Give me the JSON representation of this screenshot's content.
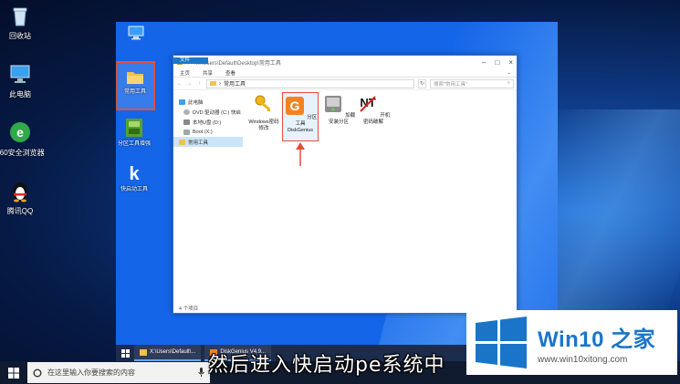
{
  "host_desktop": {
    "icons": [
      {
        "label": "回收站",
        "icon": "recycle-bin-icon"
      },
      {
        "label": "此电脑",
        "icon": "computer-icon"
      },
      {
        "label": "360安全浏览器",
        "icon": "browser-360-icon"
      },
      {
        "label": "腾讯QQ",
        "icon": "qq-penguin-icon"
      }
    ]
  },
  "vm_desktop": {
    "icons": [
      {
        "label": "",
        "icon": "computer-icon"
      },
      {
        "label": "常用工具",
        "icon": "folder-icon"
      },
      {
        "label": "分区工具增强",
        "icon": "partition-tool-icon"
      },
      {
        "label": "快启动工具",
        "icon": "k-tool-icon"
      }
    ]
  },
  "explorer": {
    "title_path": "X:\\Users\\Default\\Desktop\\常用工具",
    "ribbon_tabs": [
      "文件",
      "主页",
      "共享",
      "查看"
    ],
    "address": "常用工具",
    "search_placeholder": "搜索\"常用工具\"",
    "nav_items": [
      {
        "label": "此电脑",
        "icon": "computer-icon"
      },
      {
        "label": "DVD 驱动器 (C:) 快启",
        "icon": "dvd-drive-icon"
      },
      {
        "label": "本地U盘 (D:)",
        "icon": "usb-drive-icon"
      },
      {
        "label": "Boot (X:)",
        "icon": "drive-icon"
      },
      {
        "label": "常用工具",
        "icon": "folder-icon"
      }
    ],
    "files": [
      {
        "label": "Windows密码修改",
        "icon": "key-icon"
      },
      {
        "label": "分区工具DiskGenius",
        "icon": "diskgenius-icon"
      },
      {
        "label": "加载安装分区",
        "icon": "disk-mount-icon"
      },
      {
        "label": "开机密码破解",
        "icon": "nt-password-icon"
      }
    ],
    "status": "4 个项目"
  },
  "vm_taskbar": {
    "items": [
      "X:\\Users\\Default\\...",
      "DiskGenius V4.9..."
    ]
  },
  "host_taskbar": {
    "search_placeholder": "在这里输入你要搜索的内容"
  },
  "subtitle": "然后进入快启动pe系统中",
  "watermark": {
    "brand": "Win10",
    "brand_suffix": "之家",
    "url": "www.win10xitong.com"
  },
  "colors": {
    "vm_desktop": "#1565e8",
    "highlight_box": "#e2503a",
    "brand_blue": "#1a75c9"
  }
}
